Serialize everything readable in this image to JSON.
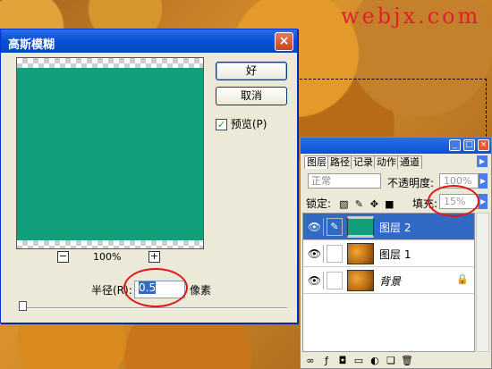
{
  "watermark": "webjx.com",
  "dialog": {
    "title": "高斯模糊",
    "close_icon": "×",
    "ok_label": "好",
    "cancel_label": "取消",
    "preview_label": "预览(P)",
    "preview_checked": true,
    "zoom_out": "−",
    "zoom_in": "+",
    "zoom_level": "100%",
    "radius_label": "半径(R):",
    "radius_value": "0.5",
    "radius_unit": "像素",
    "preview_color": "#12a07c"
  },
  "layers_panel": {
    "tabs": [
      "图层",
      "路径",
      "记录",
      "动作",
      "通道"
    ],
    "blend_mode": "正常",
    "opacity_label": "不透明度:",
    "opacity_value": "100%",
    "lock_label": "锁定:",
    "fill_label": "填充:",
    "fill_value": "15%",
    "layers": [
      {
        "name": "图层 2",
        "selected": true,
        "thumb": "green"
      },
      {
        "name": "图层 1",
        "selected": false,
        "thumb": "orange"
      },
      {
        "name": "背景",
        "selected": false,
        "thumb": "orange",
        "locked": true
      }
    ]
  }
}
